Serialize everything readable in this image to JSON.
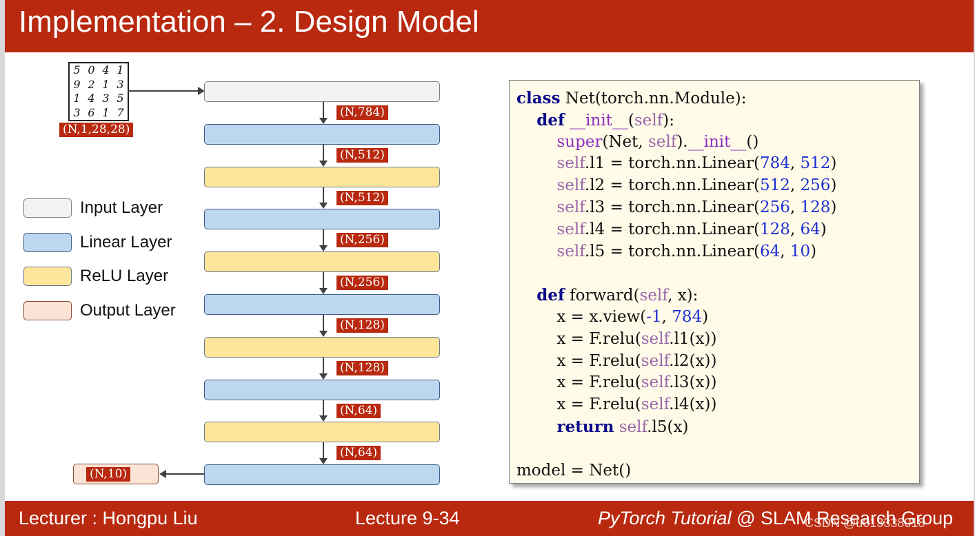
{
  "header": {
    "title": "Implementation – 2. Design Model"
  },
  "diagram": {
    "input_digits": [
      "5",
      "0",
      "4",
      "1",
      "9",
      "2",
      "1",
      "3",
      "1",
      "4",
      "3",
      "5",
      "3",
      "6",
      "1",
      "7"
    ],
    "input_shape": "(N,1,28,28)",
    "shapes": [
      "(N,784)",
      "(N,512)",
      "(N,512)",
      "(N,256)",
      "(N,256)",
      "(N,128)",
      "(N,128)",
      "(N,64)",
      "(N,64)"
    ],
    "output_shape": "(N,10)",
    "layers": [
      "input",
      "linear",
      "relu",
      "linear",
      "relu",
      "linear",
      "relu",
      "linear",
      "relu",
      "linear"
    ]
  },
  "legend": [
    {
      "label": "Input Layer",
      "color": "#f2f2f2"
    },
    {
      "label": "Linear Layer",
      "color": "#bdd7ee"
    },
    {
      "label": "ReLU Layer",
      "color": "#fde59a"
    },
    {
      "label": "Output Layer",
      "color": "#fbe3d6"
    }
  ],
  "code": {
    "lines": [
      "class Net(torch.nn.Module):",
      "    def __init__(self):",
      "        super(Net, self).__init__()",
      "        self.l1 = torch.nn.Linear(784, 512)",
      "        self.l2 = torch.nn.Linear(512, 256)",
      "        self.l3 = torch.nn.Linear(256, 128)",
      "        self.l4 = torch.nn.Linear(128, 64)",
      "        self.l5 = torch.nn.Linear(64, 10)",
      "",
      "    def forward(self, x):",
      "        x = x.view(-1, 784)",
      "        x = F.relu(self.l1(x))",
      "        x = F.relu(self.l2(x))",
      "        x = F.relu(self.l3(x))",
      "        x = F.relu(self.l4(x))",
      "        return self.l5(x)",
      "",
      "model = Net()"
    ]
  },
  "footer": {
    "lecturer": "Lecturer : Hongpu Liu",
    "lecture": "Lecture 9-34",
    "course_italic": "PyTorch Tutorial",
    "course_rest": " @ SLAM Research Group",
    "watermark": "CSDN @u013338018"
  },
  "colors": {
    "brand": "#b8290f"
  }
}
